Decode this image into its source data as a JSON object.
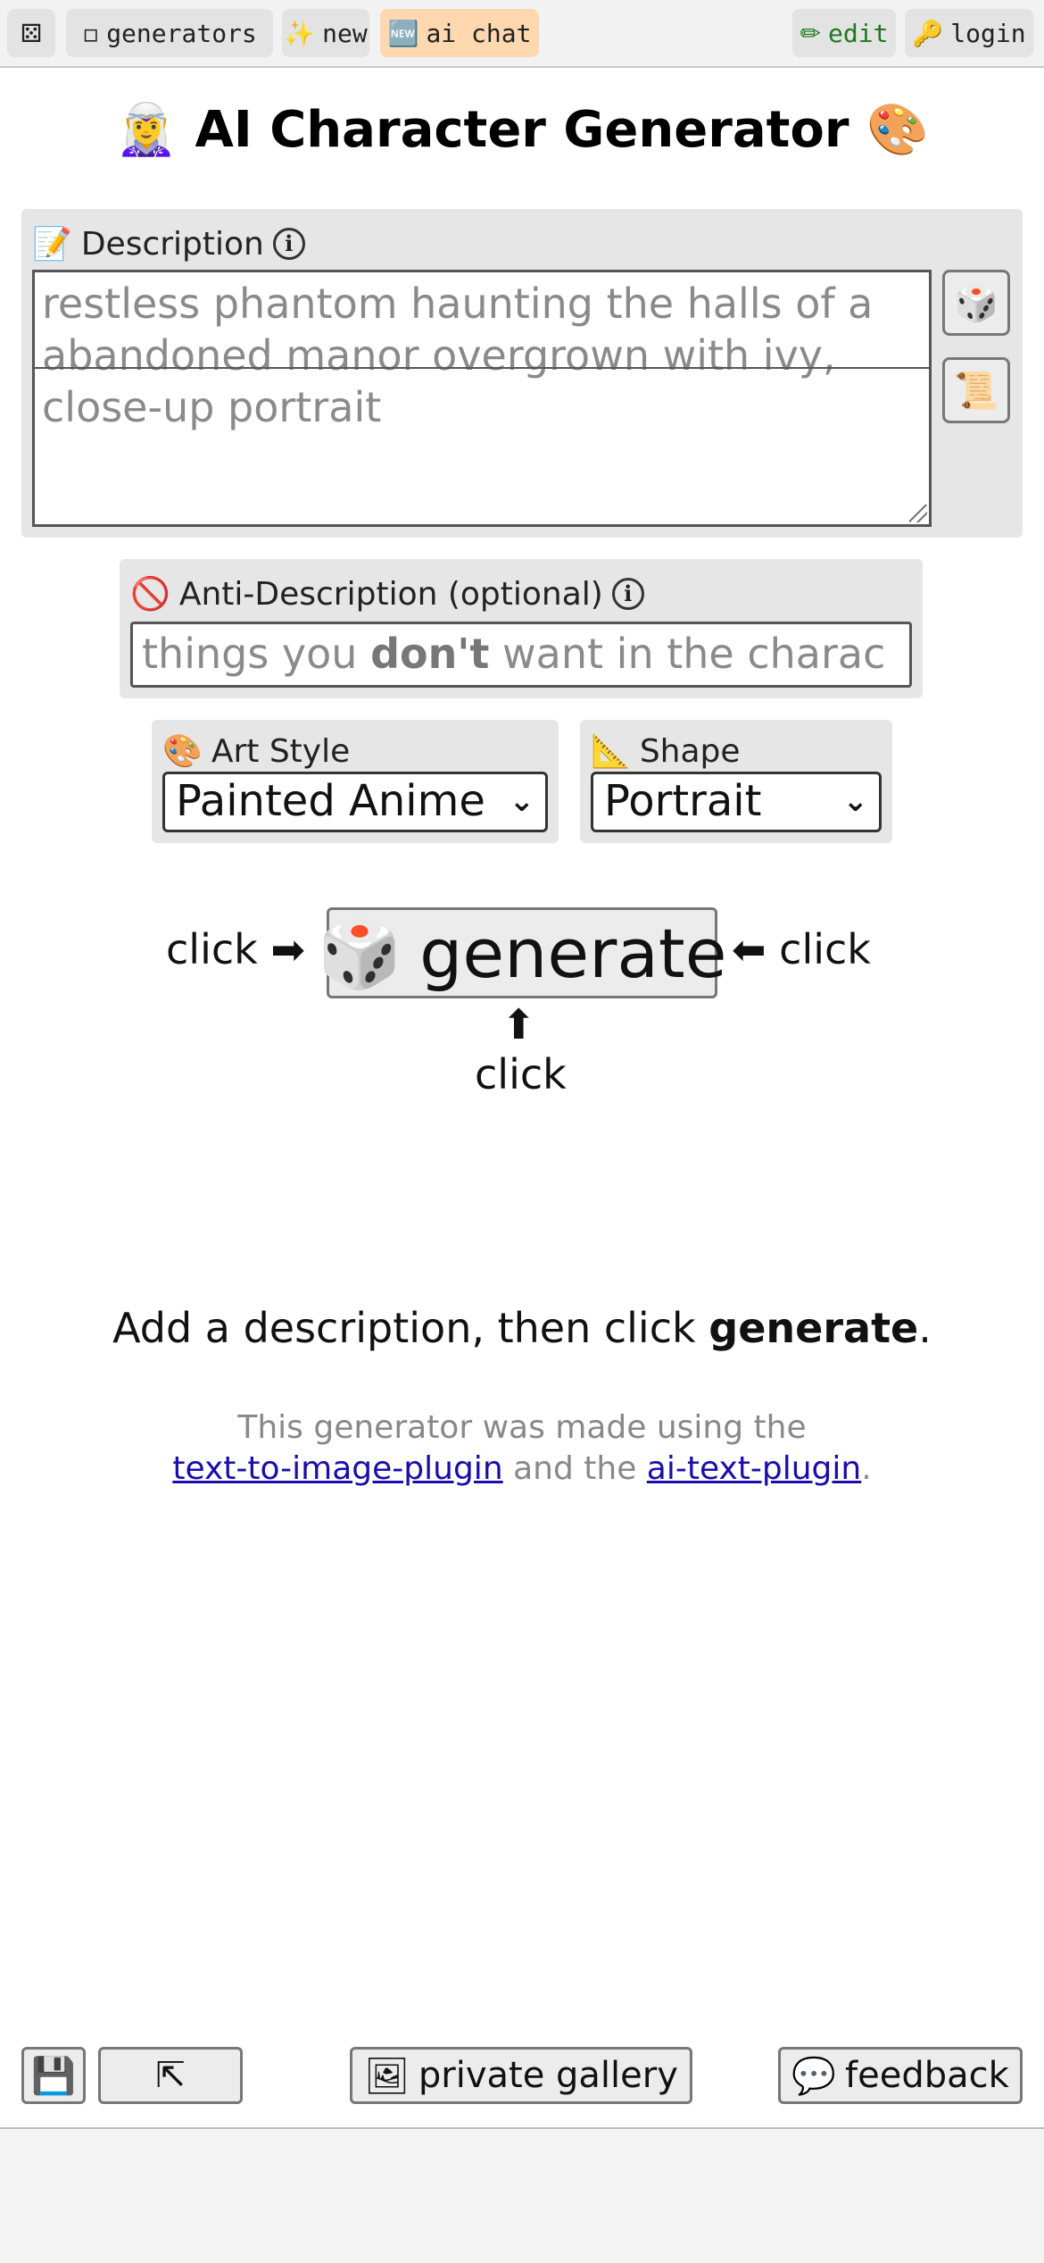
{
  "topbar": {
    "dice_icon": "⚄",
    "generators_icon": "▫",
    "generators_label": "generators",
    "new_icon": "✨",
    "new_label": "new",
    "ai_chat_icon": "🆕",
    "ai_chat_label": "ai chat",
    "edit_icon": "✏",
    "edit_label": "edit",
    "login_icon": "🔑",
    "login_label": "login",
    "colors": {
      "ai_chat_bg": "#ffd8b0",
      "edit_text": "#1a7a1a"
    }
  },
  "page": {
    "title": "🧝‍♀️ AI Character Generator 🎨"
  },
  "description": {
    "icon": "📝",
    "label": "Description",
    "info": "i",
    "placeholder_line1": "restless phantom haunting the halls of a",
    "placeholder_line2": "abandoned manor overgrown with ivy,",
    "placeholder_line3": "close-up portrait",
    "shuffle_icon": "🎲",
    "history_icon": "📜"
  },
  "anti_description": {
    "icon": "🚫",
    "label": "Anti-Description (optional)",
    "info": "i",
    "placeholder_pre": "things you ",
    "placeholder_bold": "don't",
    "placeholder_post": " want in the charac"
  },
  "art_style": {
    "icon": "🎨",
    "label": "Art Style",
    "selected": "Painted Anime"
  },
  "shape": {
    "icon": "📐",
    "label": "Shape",
    "selected": "Portrait"
  },
  "generate": {
    "icon": "🎲",
    "label": "generate",
    "click_left": "click ➡",
    "click_right": "⬅ click",
    "click_up_arrow": "⬆",
    "click_bottom": "click"
  },
  "message": {
    "pre": "Add a description, then click ",
    "bold": "generate",
    "post": "."
  },
  "footnote": {
    "line1": "This generator was made using the",
    "link1": "text-to-image-plugin",
    "mid": " and the ",
    "link2": "ai-text-plugin",
    "end": "."
  },
  "bottom": {
    "btn1_icon": "💾",
    "btn2_icon": "⇱",
    "gallery_icon": "🖼",
    "gallery_label": "private gallery",
    "feedback_icon": "💬",
    "feedback_label": "feedback"
  }
}
